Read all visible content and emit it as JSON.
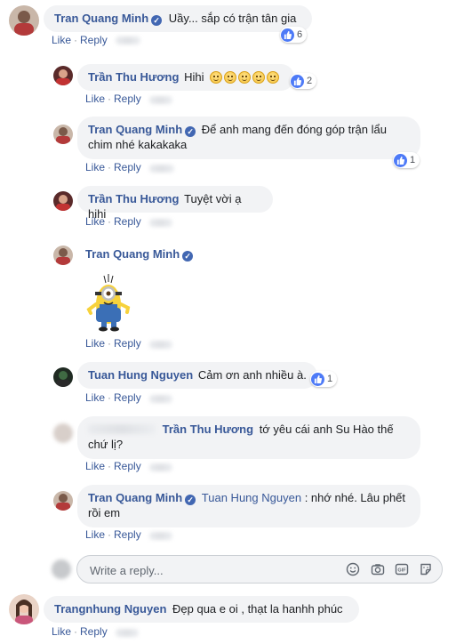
{
  "comments": {
    "c1": {
      "name": "Tran Quang Minh",
      "text": "Uầy... sắp có trận tân gia",
      "reactions": "6"
    },
    "c2": {
      "name": "Trần Thu Hương",
      "text": "Hihi",
      "reactions": "2"
    },
    "c3": {
      "name": "Tran Quang Minh",
      "text_line1": "Để anh mang đến đóng góp trận lẩu",
      "text_line2": "chim nhé kakakaka",
      "reactions": "1"
    },
    "c4": {
      "name": "Trần Thu Hương",
      "text": "Tuyệt vời ạ hihi"
    },
    "c5": {
      "name": "Tran Quang Minh",
      "sticker": "minion-sticker"
    },
    "c6": {
      "name": "Tuan Hung Nguyen",
      "text": "Cảm ơn anh nhiều à.",
      "reactions": "1"
    },
    "c7": {
      "tag": "Trần Thu Hương",
      "text_line1": "tớ yêu cái anh Su Hào thế",
      "text_line2": "chứ lị?"
    },
    "c8": {
      "name": "Tran Quang Minh",
      "tag": "Tuan Hung Nguyen",
      "text_line1": ": nhớ nhé. Lâu phết",
      "text_line2": "rồi em"
    },
    "c9": {
      "name": "Trangnhung Nguyen",
      "text": "Đẹp qua e oi , thạt la hanhh phúc"
    }
  },
  "actions": {
    "like": "Like",
    "reply": "Reply",
    "separator": "·"
  },
  "reply_box": {
    "placeholder": "Write a reply..."
  },
  "icons": [
    "verified-badge-icon",
    "like-reaction-icon",
    "smiley-emoji-icon",
    "emoji-icon",
    "camera-icon",
    "gif-icon",
    "sticker-icon"
  ],
  "colors": {
    "name": "#385898",
    "bubble": "#f2f3f5",
    "like_blue": "#4d7af7",
    "verified": "#4267b2"
  }
}
